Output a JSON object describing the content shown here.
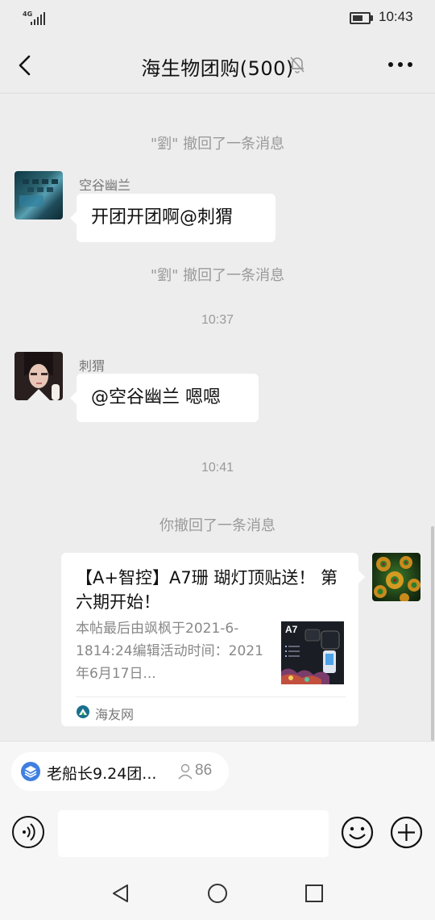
{
  "status_bar": {
    "network": "4G",
    "time": "10:43"
  },
  "header": {
    "title": "海生物团购(500)"
  },
  "messages": {
    "recall_1": "\"劉\" 撤回了一条消息",
    "msg_1": {
      "sender": "空谷幽兰",
      "text": "开团开团啊@刺猬"
    },
    "recall_2": "\"劉\" 撤回了一条消息",
    "time_1": "10:37",
    "msg_2": {
      "sender": "刺猬",
      "text": "@空谷幽兰  嗯嗯"
    },
    "time_2": "10:41",
    "recall_self": "你撤回了一条消息",
    "link_card": {
      "title": "【A+智控】A7珊 瑚灯顶贴送！ 第六期开始！",
      "description": "本帖最后由飒枫于2021-6-1814:24编辑活动时间：2021年6月17日...",
      "thumb_brand": "A7",
      "source": "海友网"
    }
  },
  "bottom": {
    "pinned_label": "老船长9.24团...",
    "pinned_count": "86",
    "input_value": ""
  },
  "icons": {
    "back": "back-arrow-icon",
    "mute": "bell-muted-icon",
    "more": "more-dots-icon",
    "voice": "voice-icon",
    "emoji": "emoji-icon",
    "plus": "plus-icon"
  },
  "colors": {
    "background": "#ededed",
    "bubble": "#ffffff",
    "system_text": "#9a9a9a",
    "pinned_icon": "#3f7fe0"
  }
}
